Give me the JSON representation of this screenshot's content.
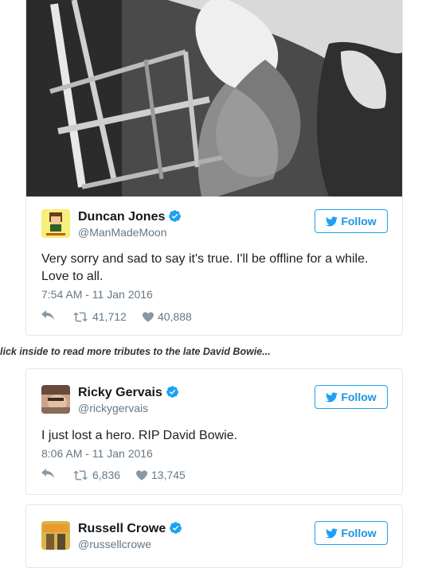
{
  "caption": "lick inside to read more tributes to the late David Bowie...",
  "tweets": [
    {
      "name": "Duncan Jones",
      "handle": "@ManMadeMoon",
      "follow_label": "Follow",
      "text_line1": "Very sorry and sad to say it's true.  I'll be offline for a while.",
      "text_line2": "Love to all.",
      "time": "7:54 AM - 11 Jan 2016",
      "retweets": "41,712",
      "likes": "40,888"
    },
    {
      "name": "Ricky Gervais",
      "handle": "@rickygervais",
      "follow_label": "Follow",
      "text_line1": "I just lost a hero. RIP David Bowie.",
      "time": "8:06 AM - 11 Jan 2016",
      "retweets": "6,836",
      "likes": "13,745"
    },
    {
      "name": "Russell Crowe",
      "handle": "@russellcrowe",
      "follow_label": "Follow"
    }
  ],
  "colors": {
    "twitter_blue": "#1da1f2",
    "verified": "#1da1f2",
    "muted": "#657786"
  }
}
